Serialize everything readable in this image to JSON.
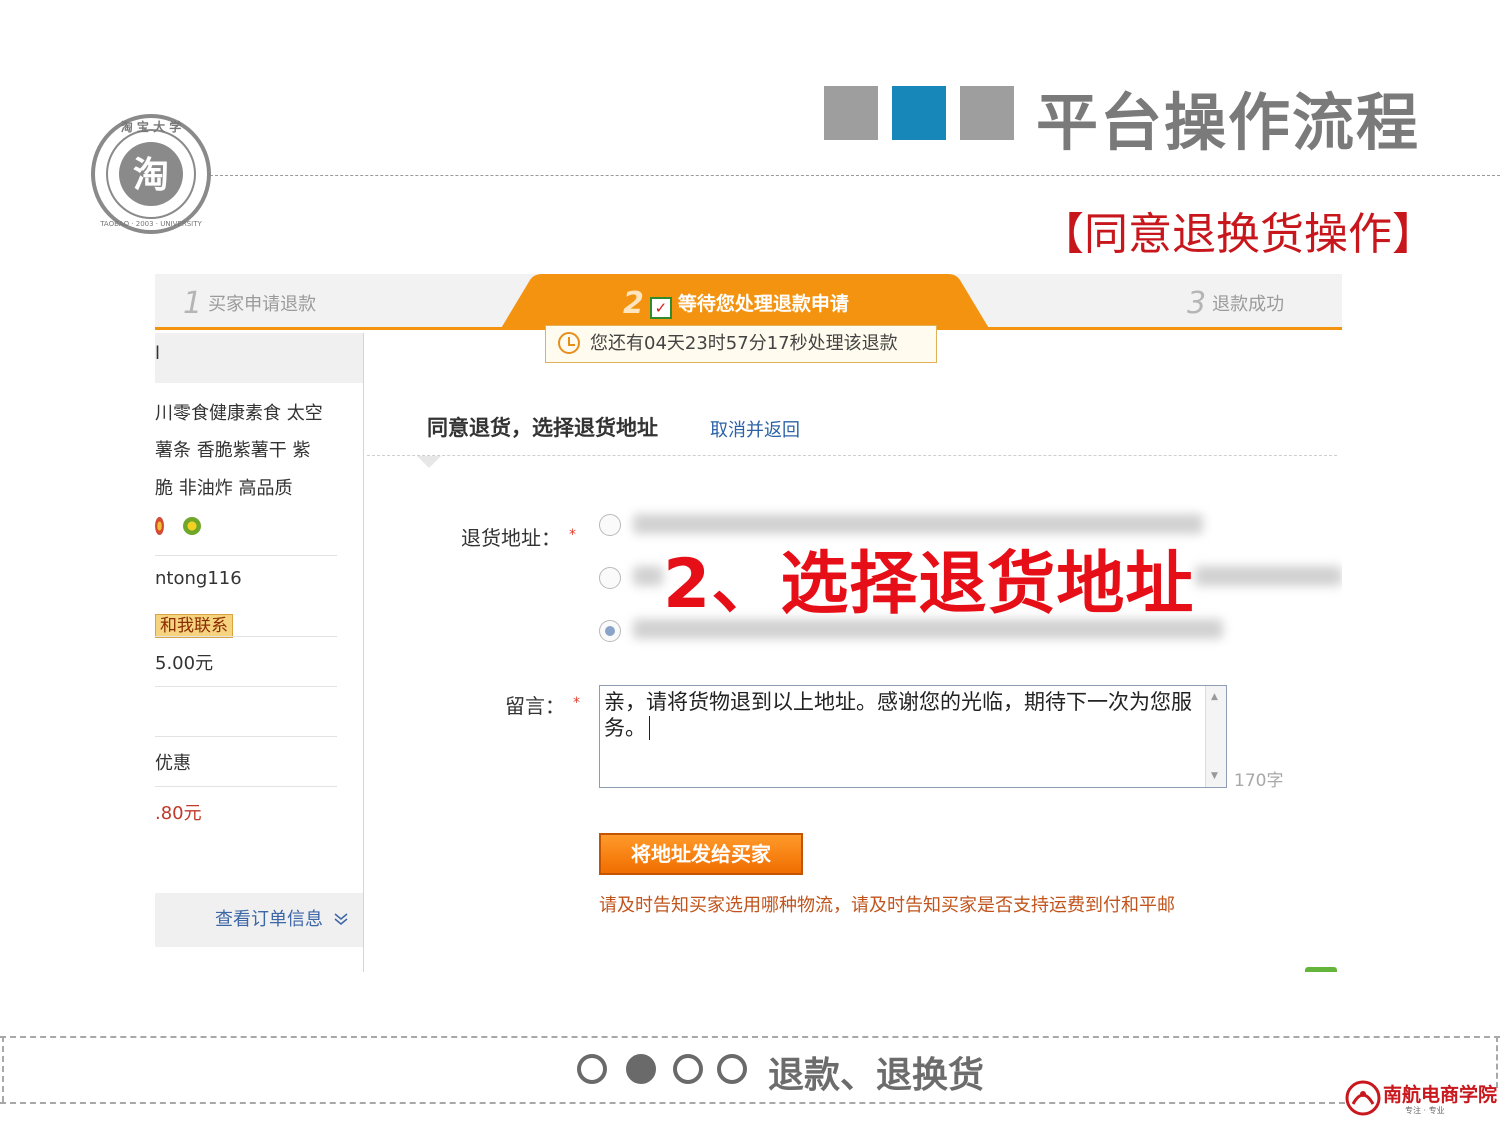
{
  "header": {
    "title": "平台操作流程",
    "subtitle": "【同意退换货操作】"
  },
  "logo": {
    "center_char": "淘",
    "ring_text": "淘宝大学",
    "en_text": "TAOBAO UNIVERSITY",
    "year": "2003"
  },
  "steps": [
    {
      "num": "1",
      "label": "买家申请退款"
    },
    {
      "num": "2",
      "label": "等待您处理退款申请"
    },
    {
      "num": "3",
      "label": "退款成功"
    }
  ],
  "timer_text": "您还有04天23时57分17秒处理该退款",
  "sidebar": {
    "head": "l",
    "product_lines": [
      "川零食健康素食 太空",
      "薯条 香脆紫薯干 紫",
      "脆 非油炸 高品质"
    ],
    "seller": "ntong116",
    "contact_label": "和我联系",
    "price": "5.00元",
    "discount": "优惠",
    "total": ".80元",
    "view_order": "查看订单信息"
  },
  "form": {
    "section_title": "同意退货，选择退货地址",
    "cancel_link": "取消并返回",
    "address_label": "退货地址：",
    "required_mark": "*",
    "message_label": "留言：",
    "message_value": "亲，请将货物退到以上地址。感谢您的光临，期待下一次为您服务。",
    "char_counter": "170字",
    "submit_label": "将地址发给买家",
    "hint": "请及时告知买家选用哪种物流，请及时告知买家是否支持运费到付和平邮"
  },
  "overlay_annotation": "2、选择退货地址",
  "footer": {
    "section_text": "退款、退换货",
    "brand": "南航电商学院",
    "brand_sub": "专注 · 专业"
  },
  "colors": {
    "accent_orange": "#f3930f",
    "title_gray": "#7a7a7a",
    "subtitle_red": "#c7171d",
    "blue_square": "#1787b9",
    "overlay_red": "#e60f17"
  }
}
